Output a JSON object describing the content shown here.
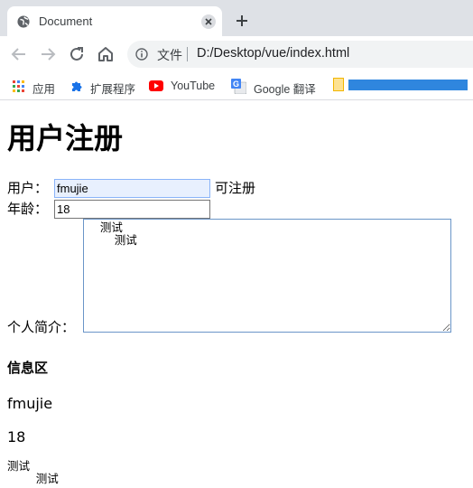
{
  "browser": {
    "tab_title": "Document",
    "address_file_label": "文件",
    "url": "D:/Desktop/vue/index.html",
    "bookmarks": [
      {
        "label": "应用",
        "icon": "apps-grid-icon"
      },
      {
        "label": "扩展程序",
        "icon": "puzzle-extension-icon"
      },
      {
        "label": "YouTube",
        "icon": "youtube-icon"
      },
      {
        "label": "Google 翻译",
        "icon": "google-translate-icon"
      }
    ],
    "colors": {
      "tabstrip": "#dee1e6",
      "omnibox": "#f1f3f4",
      "bookmark_bar_blue": "#2f86de"
    }
  },
  "page": {
    "heading": "用户注册",
    "user_label": "用户：",
    "user_value": "fmujie",
    "user_status": "可注册",
    "age_label": "年龄：",
    "age_value": "18",
    "intro_label": "个人简介：",
    "intro_value": "    测试\n        测试",
    "info_title": "信息区",
    "info_user": "fmujie",
    "info_age": "18",
    "info_intro": "测试\n        测试"
  }
}
